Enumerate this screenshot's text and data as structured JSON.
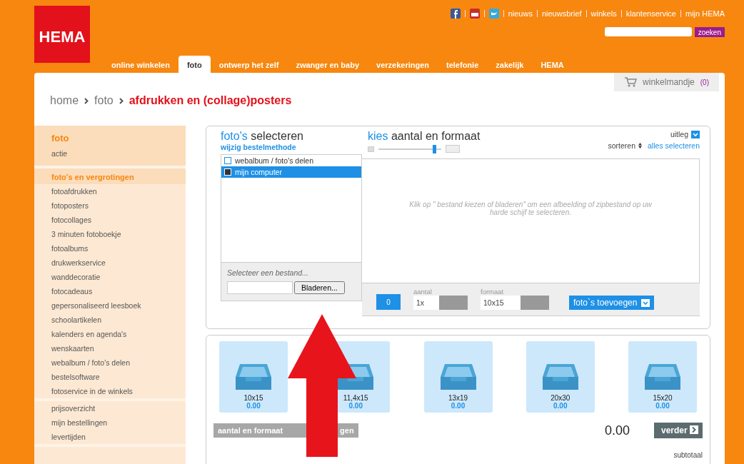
{
  "header": {
    "logo": "HEMA",
    "top_links": [
      "nieuws",
      "nieuwsbrief",
      "winkels",
      "klantenservice",
      "mijn HEMA"
    ],
    "search_button": "zoeken",
    "nav": [
      {
        "label": "online winkelen",
        "selected": false
      },
      {
        "label": "foto",
        "selected": true
      },
      {
        "label": "ontwerp het zelf",
        "selected": false
      },
      {
        "label": "zwanger en baby",
        "selected": false
      },
      {
        "label": "verzekeringen",
        "selected": false
      },
      {
        "label": "telefonie",
        "selected": false
      },
      {
        "label": "zakelijk",
        "selected": false
      },
      {
        "label": "HEMA",
        "selected": false
      }
    ]
  },
  "cart": {
    "label": "winkelmandje",
    "count": "(0)"
  },
  "breadcrumb": {
    "items": [
      "home",
      "foto"
    ],
    "current": "afdrukken en (collage)posters"
  },
  "sidebar": {
    "sections": [
      {
        "items": [
          {
            "label": "foto",
            "kind": "heading"
          },
          {
            "label": "actie",
            "kind": "link"
          }
        ]
      },
      {
        "items": [
          {
            "label": "foto's en vergrotingen",
            "kind": "heading"
          },
          {
            "label": "fotoafdrukken",
            "kind": "link"
          },
          {
            "label": "fotoposters",
            "kind": "link"
          },
          {
            "label": "fotocollages",
            "kind": "link"
          },
          {
            "label": "3 minuten fotoboekje",
            "kind": "link"
          },
          {
            "label": "fotoalbums",
            "kind": "link"
          },
          {
            "label": "drukwerkservice",
            "kind": "link"
          },
          {
            "label": "wanddecoratie",
            "kind": "link"
          },
          {
            "label": "fotocadeaus",
            "kind": "link"
          },
          {
            "label": "gepersonaliseerd leesboek",
            "kind": "link"
          },
          {
            "label": "schoolartikelen",
            "kind": "link"
          },
          {
            "label": "kalenders en agenda's",
            "kind": "link"
          },
          {
            "label": "wenskaarten",
            "kind": "link"
          },
          {
            "label": "webalbum / foto's delen",
            "kind": "link"
          },
          {
            "label": "bestelsoftware",
            "kind": "link"
          },
          {
            "label": "fotoservice in de winkels",
            "kind": "link"
          }
        ]
      },
      {
        "items": [
          {
            "label": "prijsoverzicht",
            "kind": "link"
          },
          {
            "label": "mijn bestellingen",
            "kind": "link"
          },
          {
            "label": "levertijden",
            "kind": "link"
          }
        ]
      }
    ]
  },
  "select": {
    "title_accent": "foto's",
    "title": "selecteren",
    "change_link": "wijzig bestelmethode",
    "sources": [
      {
        "label": "webalbum / foto's delen",
        "selected": false
      },
      {
        "label": "mijn computer",
        "selected": true
      }
    ],
    "file_prompt": "Selecteer een bestand...",
    "browse_button": "Bladeren..."
  },
  "quantity": {
    "title_accent": "kies",
    "title": "aantal en formaat",
    "zoom": {
      "level": 0.9
    },
    "help": "uitleg",
    "sort": "sorteren",
    "select_all": "alles selecteren",
    "empty_message": "Klik op \" bestand kiezen of bladeren\" om een afbeelding of zipbestand op uw harde schijf te selecteren.",
    "count": "0",
    "amount_label": "aantal",
    "amount": "1x",
    "format_label": "formaat",
    "format": "10x15",
    "add_button": "foto`s toevoegen"
  },
  "formats": [
    {
      "size": "10x15",
      "price": "0.00"
    },
    {
      "size": "11,4x15",
      "price": "0.00"
    },
    {
      "size": "13x19",
      "price": "0.00"
    },
    {
      "size": "20x30",
      "price": "0.00"
    },
    {
      "size": "15x20",
      "price": "0.00"
    }
  ],
  "summary": {
    "change_button": "aantal en formaat",
    "change_button_tail": "gen",
    "total": "0.00",
    "next_button": "verder",
    "subtotal_label": "subtotaal"
  }
}
